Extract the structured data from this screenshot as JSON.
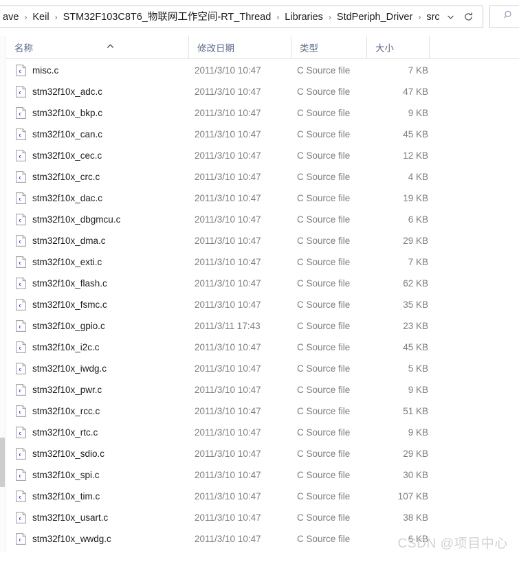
{
  "window": {
    "type": "file-explorer"
  },
  "addressbar": {
    "crumbs": [
      "ave",
      "Keil",
      "STM32F103C8T6_物联网工作空间-RT_Thread",
      "Libraries",
      "StdPeriph_Driver",
      "src"
    ],
    "separator": "›",
    "history_dropdown_icon": "chevron-down-icon",
    "refresh_icon": "refresh-icon"
  },
  "search": {
    "icon": "search-icon",
    "placeholder": ""
  },
  "columns": [
    {
      "label": "名称",
      "key": "name"
    },
    {
      "label": "修改日期",
      "key": "date"
    },
    {
      "label": "类型",
      "key": "type"
    },
    {
      "label": "大小",
      "key": "size"
    }
  ],
  "sort": {
    "column": "名称",
    "direction": "asc",
    "indicator_icon": "caret-up-icon"
  },
  "files": [
    {
      "name": "misc.c",
      "date": "2011/3/10 10:47",
      "type": "C Source file",
      "size": "7 KB"
    },
    {
      "name": "stm32f10x_adc.c",
      "date": "2011/3/10 10:47",
      "type": "C Source file",
      "size": "47 KB"
    },
    {
      "name": "stm32f10x_bkp.c",
      "date": "2011/3/10 10:47",
      "type": "C Source file",
      "size": "9 KB"
    },
    {
      "name": "stm32f10x_can.c",
      "date": "2011/3/10 10:47",
      "type": "C Source file",
      "size": "45 KB"
    },
    {
      "name": "stm32f10x_cec.c",
      "date": "2011/3/10 10:47",
      "type": "C Source file",
      "size": "12 KB"
    },
    {
      "name": "stm32f10x_crc.c",
      "date": "2011/3/10 10:47",
      "type": "C Source file",
      "size": "4 KB"
    },
    {
      "name": "stm32f10x_dac.c",
      "date": "2011/3/10 10:47",
      "type": "C Source file",
      "size": "19 KB"
    },
    {
      "name": "stm32f10x_dbgmcu.c",
      "date": "2011/3/10 10:47",
      "type": "C Source file",
      "size": "6 KB"
    },
    {
      "name": "stm32f10x_dma.c",
      "date": "2011/3/10 10:47",
      "type": "C Source file",
      "size": "29 KB"
    },
    {
      "name": "stm32f10x_exti.c",
      "date": "2011/3/10 10:47",
      "type": "C Source file",
      "size": "7 KB"
    },
    {
      "name": "stm32f10x_flash.c",
      "date": "2011/3/10 10:47",
      "type": "C Source file",
      "size": "62 KB"
    },
    {
      "name": "stm32f10x_fsmc.c",
      "date": "2011/3/10 10:47",
      "type": "C Source file",
      "size": "35 KB"
    },
    {
      "name": "stm32f10x_gpio.c",
      "date": "2011/3/11 17:43",
      "type": "C Source file",
      "size": "23 KB"
    },
    {
      "name": "stm32f10x_i2c.c",
      "date": "2011/3/10 10:47",
      "type": "C Source file",
      "size": "45 KB"
    },
    {
      "name": "stm32f10x_iwdg.c",
      "date": "2011/3/10 10:47",
      "type": "C Source file",
      "size": "5 KB"
    },
    {
      "name": "stm32f10x_pwr.c",
      "date": "2011/3/10 10:47",
      "type": "C Source file",
      "size": "9 KB"
    },
    {
      "name": "stm32f10x_rcc.c",
      "date": "2011/3/10 10:47",
      "type": "C Source file",
      "size": "51 KB"
    },
    {
      "name": "stm32f10x_rtc.c",
      "date": "2011/3/10 10:47",
      "type": "C Source file",
      "size": "9 KB"
    },
    {
      "name": "stm32f10x_sdio.c",
      "date": "2011/3/10 10:47",
      "type": "C Source file",
      "size": "29 KB"
    },
    {
      "name": "stm32f10x_spi.c",
      "date": "2011/3/10 10:47",
      "type": "C Source file",
      "size": "30 KB"
    },
    {
      "name": "stm32f10x_tim.c",
      "date": "2011/3/10 10:47",
      "type": "C Source file",
      "size": "107 KB"
    },
    {
      "name": "stm32f10x_usart.c",
      "date": "2011/3/10 10:47",
      "type": "C Source file",
      "size": "38 KB"
    },
    {
      "name": "stm32f10x_wwdg.c",
      "date": "2011/3/10 10:47",
      "type": "C Source file",
      "size": "6 KB"
    }
  ],
  "watermark": {
    "text": "CSDN @项目中心"
  },
  "colors": {
    "icon_letter": "#3b4fcc",
    "header_text": "#5a6b87",
    "secondary_text": "#7c7c7c",
    "primary_text": "#1b1b1b",
    "watermark": "#d2d2d2",
    "border": "#cfcfcf"
  }
}
